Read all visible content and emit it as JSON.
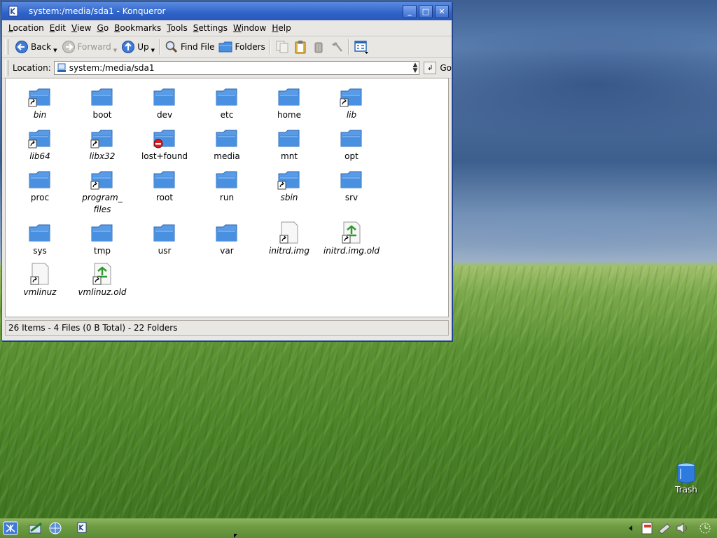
{
  "window": {
    "title": "system:/media/sda1 - Konqueror",
    "buttons": [
      "_",
      "□",
      "✕"
    ]
  },
  "menu": [
    "Location",
    "Edit",
    "View",
    "Go",
    "Bookmarks",
    "Tools",
    "Settings",
    "Window",
    "Help"
  ],
  "toolbar": {
    "back": "Back",
    "forward": "Forward",
    "up": "Up",
    "find_file": "Find File",
    "folders": "Folders"
  },
  "location": {
    "label": "Location:",
    "value": "system:/media/sda1",
    "go": "Go"
  },
  "files": [
    {
      "name": "bin",
      "kind": "folder-link"
    },
    {
      "name": "boot",
      "kind": "folder"
    },
    {
      "name": "dev",
      "kind": "folder"
    },
    {
      "name": "etc",
      "kind": "folder"
    },
    {
      "name": "home",
      "kind": "folder"
    },
    {
      "name": "lib",
      "kind": "folder-link"
    },
    {
      "name": "lib64",
      "kind": "folder-link"
    },
    {
      "name": "libx32",
      "kind": "folder-link"
    },
    {
      "name": "lost+found",
      "kind": "folder-locked"
    },
    {
      "name": "media",
      "kind": "folder"
    },
    {
      "name": "mnt",
      "kind": "folder"
    },
    {
      "name": "opt",
      "kind": "folder"
    },
    {
      "name": "proc",
      "kind": "folder"
    },
    {
      "name": "program_\nfiles",
      "kind": "folder-link"
    },
    {
      "name": "root",
      "kind": "folder"
    },
    {
      "name": "run",
      "kind": "folder"
    },
    {
      "name": "sbin",
      "kind": "folder-link"
    },
    {
      "name": "srv",
      "kind": "folder"
    },
    {
      "name": "sys",
      "kind": "folder"
    },
    {
      "name": "tmp",
      "kind": "folder"
    },
    {
      "name": "usr",
      "kind": "folder"
    },
    {
      "name": "var",
      "kind": "folder"
    },
    {
      "name": "initrd.img",
      "kind": "file-link"
    },
    {
      "name": "initrd.img.old",
      "kind": "file-link-recycle"
    },
    {
      "name": "vmlinuz",
      "kind": "file-link"
    },
    {
      "name": "vmlinuz.old",
      "kind": "file-link-recycle"
    }
  ],
  "status": "26 Items - 4 Files (0 B Total) - 22 Folders",
  "desktop": {
    "trash_label": "Trash"
  },
  "colors": {
    "titlebar": "#2f63c9",
    "folder": "#4a90e0"
  }
}
